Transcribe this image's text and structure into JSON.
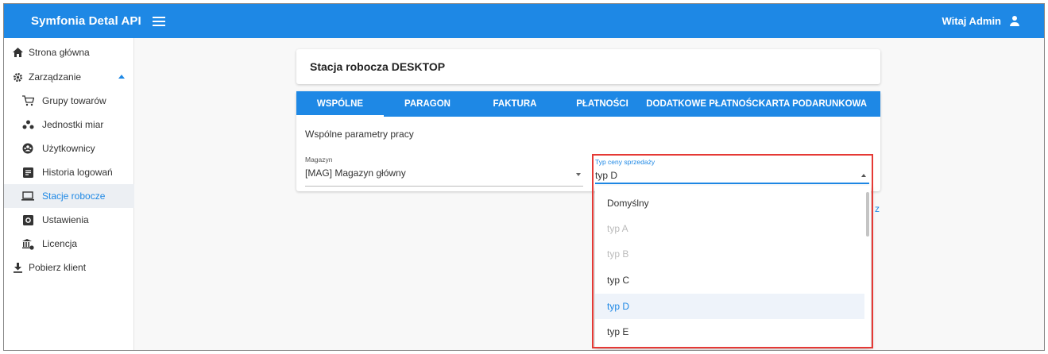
{
  "app": {
    "title": "Symfonia Detal API",
    "greeting": "Witaj Admin",
    "accent_color": "#1e88e5",
    "highlight_color": "#e53935"
  },
  "sidebar": {
    "items": [
      {
        "label": "Strona główna",
        "icon": "home-icon"
      },
      {
        "label": "Zarządzanie",
        "icon": "gear-icon"
      },
      {
        "label": "Grupy towarów",
        "icon": "cart-icon"
      },
      {
        "label": "Jednostki miar",
        "icon": "dots-icon"
      },
      {
        "label": "Użytkownicy",
        "icon": "users-icon"
      },
      {
        "label": "Historia logowań",
        "icon": "history-icon"
      },
      {
        "label": "Stacje robocze",
        "icon": "laptop-icon"
      },
      {
        "label": "Ustawienia",
        "icon": "settings-box-icon"
      },
      {
        "label": "Licencja",
        "icon": "license-icon"
      },
      {
        "label": "Pobierz klient",
        "icon": "download-icon"
      }
    ]
  },
  "page": {
    "title": "Stacja robocza DESKTOP",
    "tabs": [
      {
        "label": "WSPÓLNE"
      },
      {
        "label": "PARAGON"
      },
      {
        "label": "FAKTURA"
      },
      {
        "label": "PŁATNOŚCI"
      },
      {
        "label": "DODATKOWE PŁATNOŚCI"
      },
      {
        "label": "KARTA PODARUNKOWA"
      }
    ],
    "section_label": "Wspólne parametry pracy",
    "magazyn": {
      "label": "Magazyn",
      "value": "[MAG] Magazyn główny"
    },
    "typ_ceny": {
      "label": "Typ ceny sprzedaży",
      "value": "typ D",
      "options": [
        {
          "label": "Domyślny",
          "disabled": false,
          "selected": false
        },
        {
          "label": "typ A",
          "disabled": true,
          "selected": false
        },
        {
          "label": "typ B",
          "disabled": true,
          "selected": false
        },
        {
          "label": "typ C",
          "disabled": false,
          "selected": false
        },
        {
          "label": "typ D",
          "disabled": false,
          "selected": true
        },
        {
          "label": "typ E",
          "disabled": false,
          "selected": false
        }
      ]
    },
    "partial_text": "z"
  }
}
